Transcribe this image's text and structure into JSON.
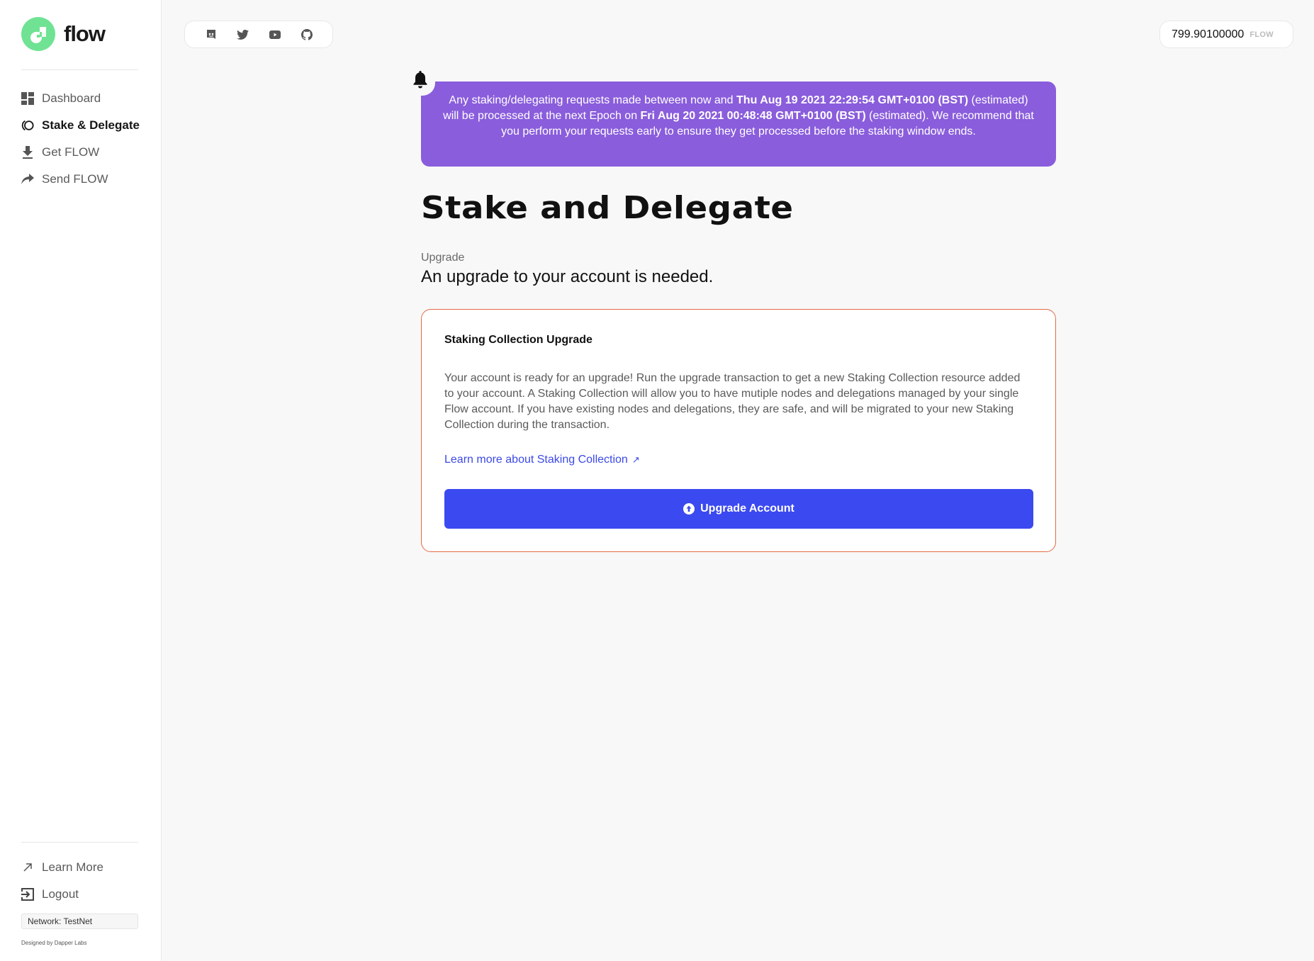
{
  "brand": {
    "name": "flow",
    "logo_color": "#6fe393"
  },
  "sidebar": {
    "items": [
      {
        "label": "Dashboard",
        "icon": "dashboard-icon",
        "active": false
      },
      {
        "label": "Stake & Delegate",
        "icon": "stake-icon",
        "active": true
      },
      {
        "label": "Get FLOW",
        "icon": "download-icon",
        "active": false
      },
      {
        "label": "Send FLOW",
        "icon": "share-arrow-icon",
        "active": false
      }
    ],
    "bottom_items": [
      {
        "label": "Learn More",
        "icon": "external-arrow-icon"
      },
      {
        "label": "Logout",
        "icon": "logout-icon"
      }
    ],
    "network": "Network: TestNet",
    "designed_by": "Designed by Dapper Labs"
  },
  "topbar": {
    "social": [
      "discord-icon",
      "twitter-icon",
      "youtube-icon",
      "github-icon"
    ],
    "balance": {
      "value": "799.90100000",
      "unit": "FLOW"
    }
  },
  "banner": {
    "icon": "bell-icon",
    "color": "#8a5ddc",
    "text_1": "Any staking/delegating requests made between now and ",
    "date_1": "Thu Aug 19 2021 22:29:54 GMT+0100 (BST)",
    "text_2": " (estimated) will be processed at the next Epoch on ",
    "date_2": "Fri Aug 20 2021 00:48:48 GMT+0100 (BST)",
    "text_3": " (estimated). We recommend that you perform your requests early to ensure they get processed before the staking window ends."
  },
  "main": {
    "title": "Stake and Delegate",
    "section_label": "Upgrade",
    "section_subtitle": "An upgrade to your account is needed.",
    "card": {
      "title": "Staking Collection Upgrade",
      "body": "Your account is ready for an upgrade! Run the upgrade transaction to get a new Staking Collection resource added to your account. A Staking Collection will allow you to have mutiple nodes and delegations managed by your single Flow account. If you have existing nodes and delegations, they are safe, and will be migrated to your new Staking Collection during the transaction.",
      "link_label": "Learn more about Staking Collection",
      "link_arrow": "↗",
      "button_label": "Upgrade Account",
      "button_icon": "arrow-up-circle-icon",
      "border_color": "#e26a45",
      "button_color": "#3b49f0"
    }
  }
}
